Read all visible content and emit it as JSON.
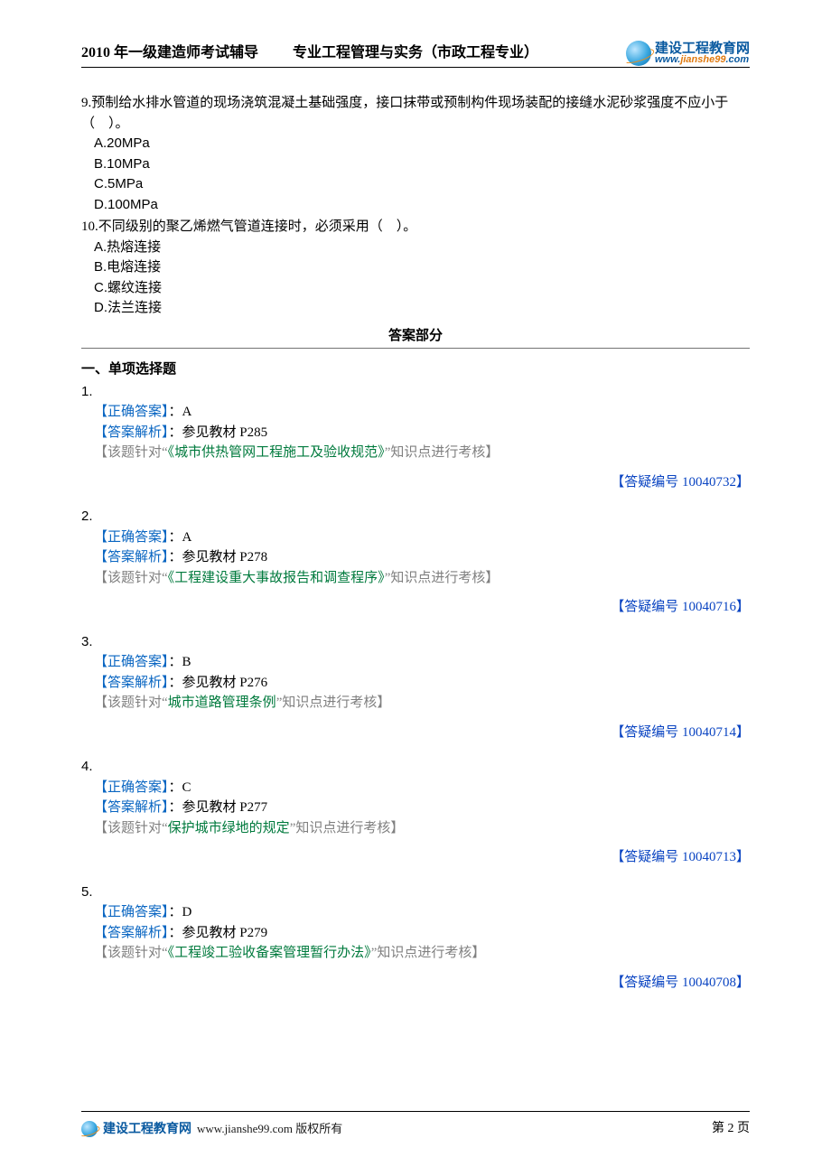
{
  "header": {
    "left": "2010 年一级建造师考试辅导",
    "mid": "专业工程管理与实务（市政工程专业）",
    "logo_cn": "建设工程教育网",
    "logo_en_pre": "www.",
    "logo_en_accent": "jianshe99",
    "logo_en_post": ".com"
  },
  "questions": [
    {
      "num": "9.",
      "text": "预制给水排水管道的现场浇筑混凝土基础强度，接口抹带或预制构件现场装配的接缝水泥砂浆强度不应小于（　）。",
      "opts": [
        "A.20MPa",
        "B.10MPa",
        "C.5MPa",
        "D.100MPa"
      ]
    },
    {
      "num": "10.",
      "text": "不同级别的聚乙烯燃气管道连接时，必须采用（　）。",
      "opts": [
        "A.热熔连接",
        "B.电熔连接",
        "C.螺纹连接",
        "D.法兰连接"
      ]
    }
  ],
  "answers_header": "答案部分",
  "section_title": "一、单项选择题",
  "labels": {
    "correct": "【正确答案】",
    "analysis": "【答案解析】",
    "note_pre": "【该题针对“",
    "note_post_kp": "”知识点进行考核】",
    "ref_pre": "【答疑编号 ",
    "ref_post": "】"
  },
  "answers": [
    {
      "n": "1.",
      "correct": "：A",
      "analysis": "：参见教材 P285",
      "topic": "《城市供热管网工程施工及验收规范》",
      "ref": "10040732"
    },
    {
      "n": "2.",
      "correct": "：A",
      "analysis": "：参见教材 P278",
      "topic": "《工程建设重大事故报告和调查程序》",
      "ref": "10040716"
    },
    {
      "n": "3.",
      "correct": "：B",
      "analysis": "：参见教材 P276",
      "topic": "城市道路管理条例",
      "ref": "10040714"
    },
    {
      "n": "4.",
      "correct": "：C",
      "analysis": "：参见教材 P277",
      "topic": "保护城市绿地的规定",
      "ref": "10040713"
    },
    {
      "n": "5.",
      "correct": "：D",
      "analysis": "：参见教材 P279",
      "topic": "《工程竣工验收备案管理暂行办法》",
      "ref": "10040708"
    }
  ],
  "footer": {
    "brand": "建设工程教育网",
    "url_text": "www.jianshe99.com 版权所有",
    "page": "第 2 页"
  }
}
